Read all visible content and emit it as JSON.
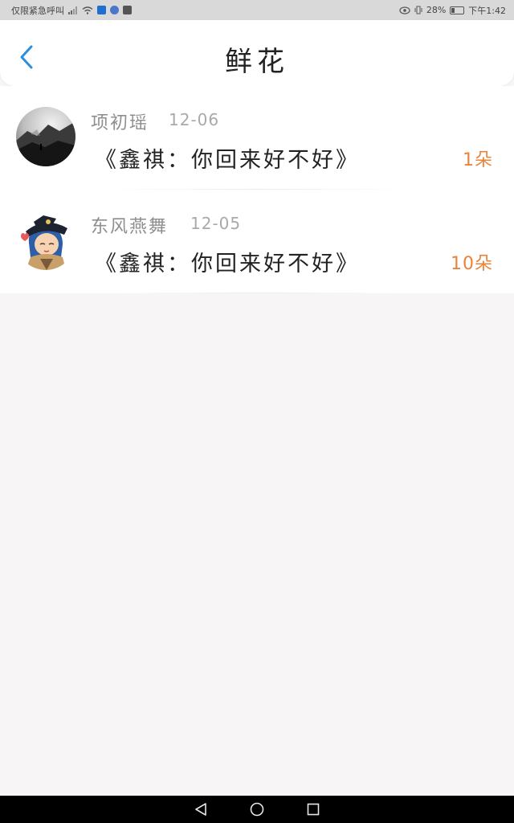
{
  "status_bar": {
    "carrier": "仅限紧急呼叫",
    "battery_percent": "28%",
    "time": "下午1:42"
  },
  "header": {
    "title": "鲜花",
    "back_icon": "chevron-left-icon",
    "accent_color": "#2a8fe0"
  },
  "items": [
    {
      "name": "项初瑶",
      "date": "12-06",
      "message": "《鑫祺：你回来好不好》",
      "count": "1朵",
      "avatar_icon": "avatar-mountain-icon"
    },
    {
      "name": "东风燕舞",
      "date": "12-05",
      "message": "《鑫祺：你回来好不好》",
      "count": "10朵",
      "avatar_icon": "avatar-pirate-girl-icon"
    }
  ],
  "colors": {
    "count": "#e8833a",
    "name": "#8e8e8e",
    "date": "#a9a9a9"
  },
  "nav_bar": {
    "back": "triangle-back-icon",
    "home": "circle-home-icon",
    "recents": "square-recents-icon"
  }
}
